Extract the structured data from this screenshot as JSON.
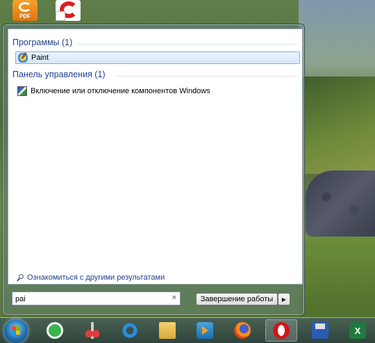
{
  "desktop": {
    "icons": [
      {
        "name": "pdf-app-icon",
        "label": "PDF"
      },
      {
        "name": "red-app-shortcut-icon"
      }
    ]
  },
  "start_menu": {
    "groups": [
      {
        "title": "Программы (1)",
        "items": [
          {
            "label": "Paint",
            "icon": "paint-icon",
            "selected": true
          }
        ]
      },
      {
        "title": "Панель управления (1)",
        "items": [
          {
            "label": "Включение или отключение компонентов Windows",
            "icon": "control-panel-icon",
            "selected": false
          }
        ]
      }
    ],
    "more_results": "Ознакомиться с другими результатами",
    "search": {
      "value": "pai",
      "clear_glyph": "×"
    },
    "shutdown": {
      "label": "Завершение работы",
      "arrow": "▶"
    }
  },
  "taskbar": {
    "items": [
      {
        "name": "start-orb"
      },
      {
        "name": "green-app-icon"
      },
      {
        "name": "scissors-icon"
      },
      {
        "name": "internet-explorer-icon",
        "glyph": "e"
      },
      {
        "name": "file-explorer-icon"
      },
      {
        "name": "media-player-icon"
      },
      {
        "name": "firefox-icon"
      },
      {
        "name": "opera-icon",
        "active": true
      },
      {
        "name": "save-floppy-icon"
      },
      {
        "name": "excel-icon",
        "glyph": "X"
      }
    ]
  }
}
